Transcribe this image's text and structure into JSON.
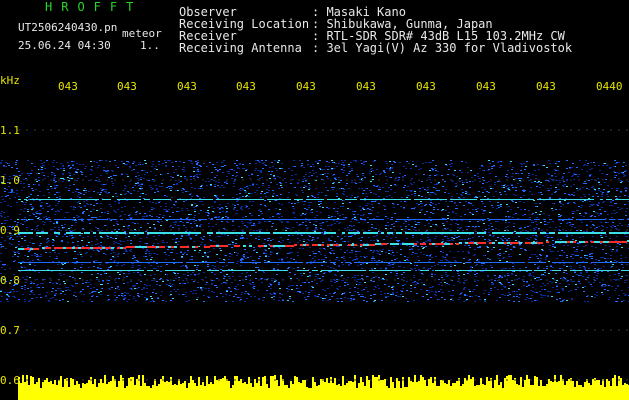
{
  "header": {
    "brand": "HROFFT",
    "filename": "UT2506240430.pn",
    "suffix": "meteor",
    "datetime": "25.06.24 04:30",
    "count": "1..",
    "labels": [
      "Observer",
      "Receiving Location",
      "Receiver",
      "Receiving Antenna"
    ],
    "values": [
      ": Masaki Kano",
      ": Shibukawa, Gunma, Japan",
      ": RTL-SDR SDR# 43dB L15 103.2MHz CW",
      ": 3el Yagi(V) Az 330 for Vladivostok"
    ]
  },
  "plot": {
    "unit_label": "kHz",
    "time_ticks": [
      "043",
      "043",
      "043",
      "043",
      "043",
      "043",
      "043",
      "043",
      "043",
      "0440"
    ],
    "freq_ticks": [
      "1.1",
      "1.0",
      "0.9",
      "0.8",
      "0.7",
      "0.6"
    ],
    "colors": {
      "background": "#000000",
      "weak": "#0b2a9a",
      "mid": "#1e6cff",
      "strong": "#39e0e8",
      "peak": "#ff2a2a",
      "ground": "#ffff00"
    }
  }
}
